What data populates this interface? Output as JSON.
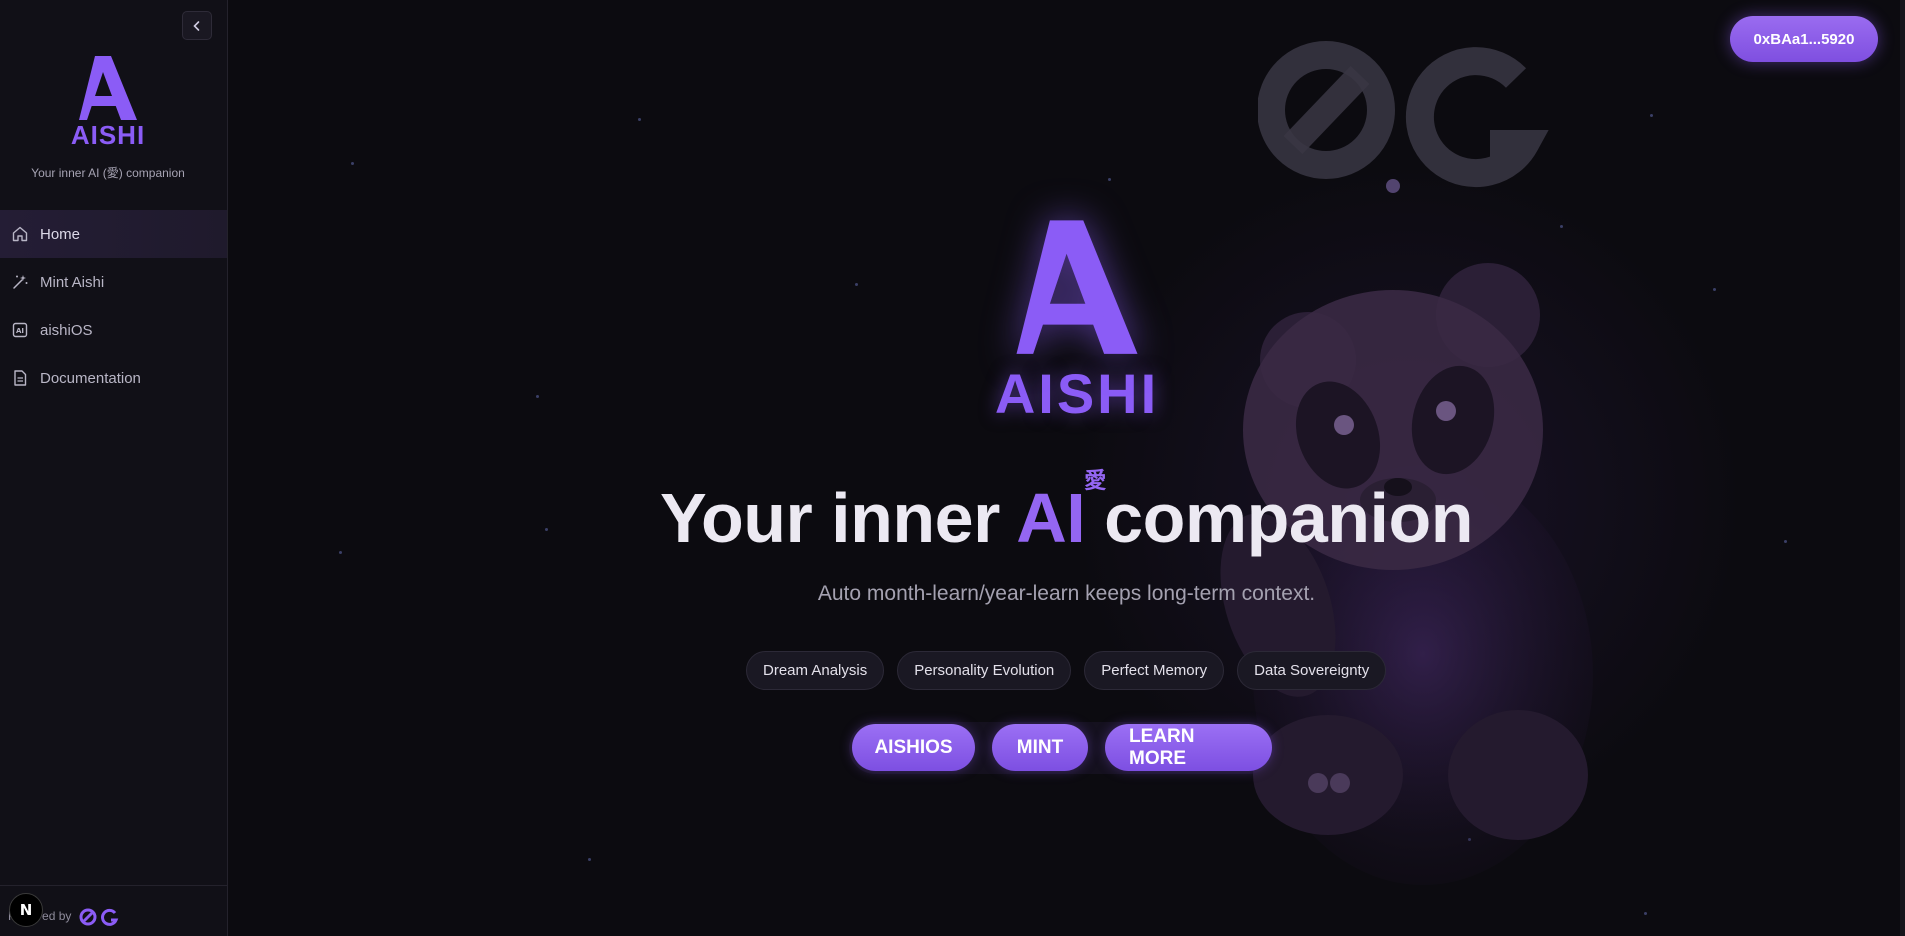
{
  "sidebar": {
    "brand": "AISHI",
    "tagline": "Your inner AI (愛) companion",
    "items": [
      {
        "label": "Home",
        "icon": "home-icon",
        "active": true
      },
      {
        "label": "Mint Aishi",
        "icon": "magic-wand-icon",
        "active": false
      },
      {
        "label": "aishiOS",
        "icon": "ai-chip-icon",
        "active": false
      },
      {
        "label": "Documentation",
        "icon": "document-icon",
        "active": false
      }
    ],
    "footer": {
      "powered_by": "Powered by",
      "logo": "0G"
    },
    "next_badge": "N"
  },
  "header": {
    "wallet": "0xBAa1...5920"
  },
  "hero": {
    "brand": "AISHI",
    "headline_pre": "Your inner",
    "headline_ai": "AI",
    "headline_kanji": "愛",
    "headline_post": "companion",
    "subline": "Auto month-learn/year-learn keeps long-term context.",
    "features": [
      "Dream Analysis",
      "Personality Evolution",
      "Perfect Memory",
      "Data Sovereignty"
    ],
    "buttons": {
      "aishios": "AISHIOS",
      "mint": "MINT",
      "learn_more": "LEARN MORE"
    }
  },
  "colors": {
    "accent": "#8b5cf6",
    "background": "#0c0b10",
    "sidebar": "#111017"
  }
}
